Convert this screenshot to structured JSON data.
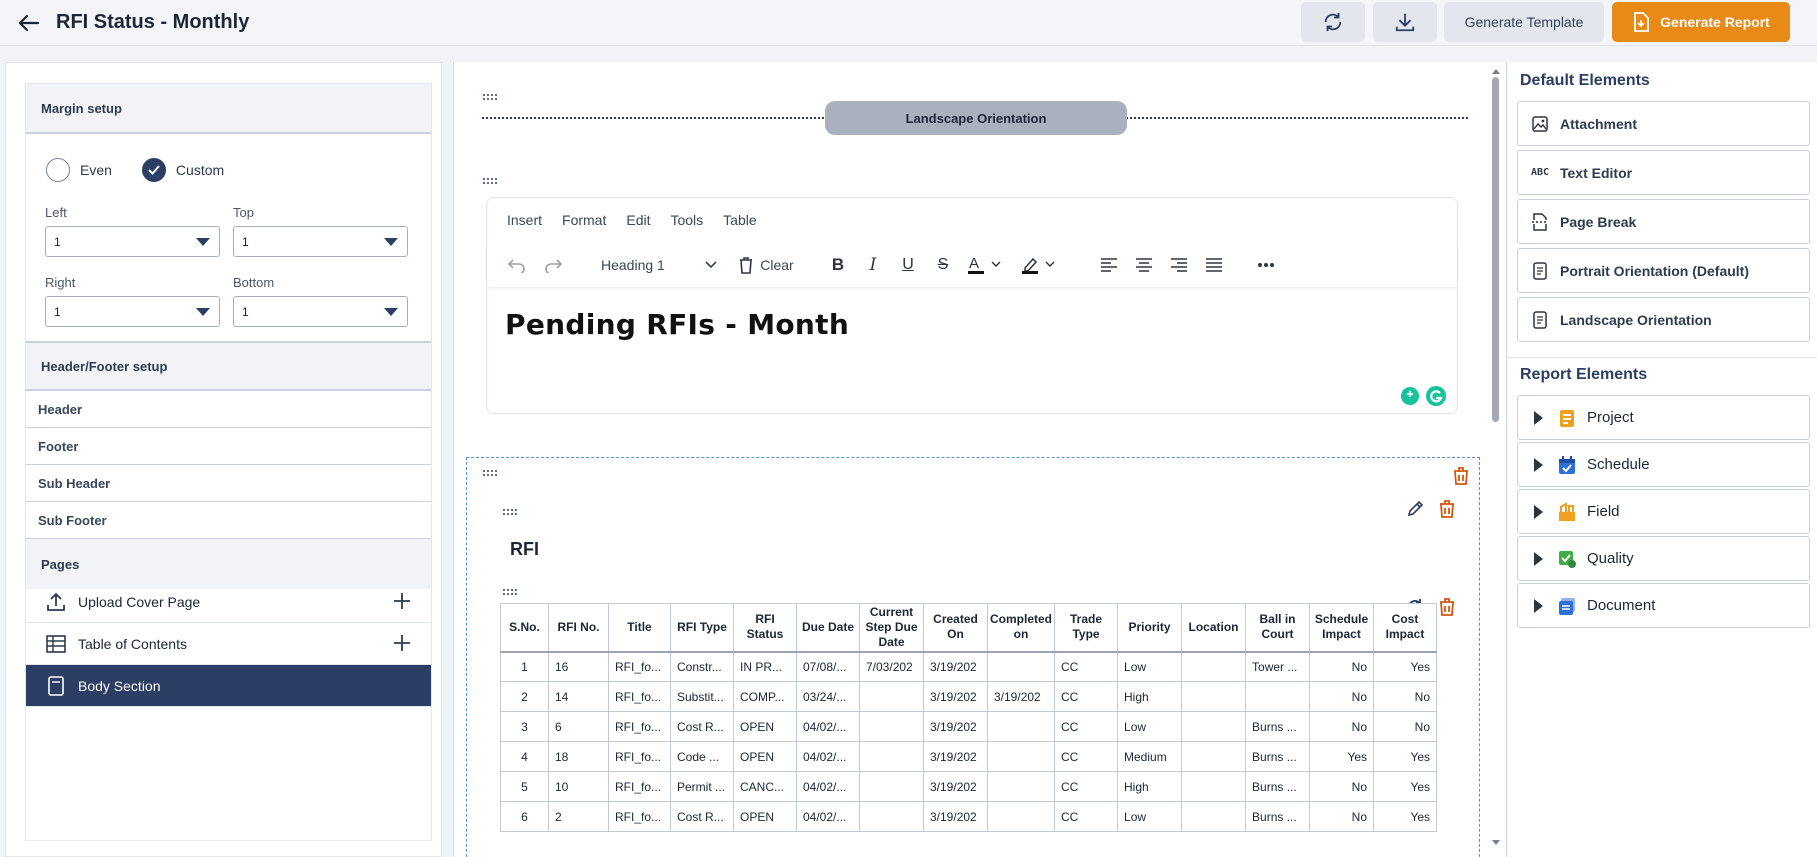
{
  "header": {
    "title": "RFI Status - Monthly",
    "generate_template": "Generate Template",
    "generate_report": "Generate Report",
    "refresh_icon": "refresh-icon",
    "download_icon": "download-icon",
    "accent_color": "#e98a16"
  },
  "left": {
    "margin_setup": "Margin setup",
    "radio_even": "Even",
    "radio_custom": "Custom",
    "selected_mode": "Custom",
    "left_label": "Left",
    "left_value": "1",
    "top_label": "Top",
    "top_value": "1",
    "right_label": "Right",
    "right_value": "1",
    "bottom_label": "Bottom",
    "bottom_value": "1",
    "header_footer_setup": "Header/Footer setup",
    "hf_items": [
      "Header",
      "Footer",
      "Sub Header",
      "Sub Footer"
    ],
    "pages_label": "Pages",
    "pages": [
      "Upload Cover Page",
      "Table of Contents",
      "Body Section"
    ],
    "active_page": "Body Section",
    "active_color": "#2c3e63"
  },
  "center": {
    "landscape_label": "Landscape Orientation",
    "menu": [
      "Insert",
      "Format",
      "Edit",
      "Tools",
      "Table"
    ],
    "heading_style": "Heading 1",
    "clear_label": "Clear",
    "content": "Pending RFIs - Month",
    "rfi_title": "RFI",
    "table": {
      "headers": [
        "S.No.",
        "RFI No.",
        "Title",
        "RFI Type",
        "RFI Status",
        "Due Date",
        "Current Step Due Date",
        "Created On",
        "Completed on",
        "Trade Type",
        "Priority",
        "Location",
        "Ball in Court",
        "Schedule Impact",
        "Cost Impact"
      ],
      "rows": [
        [
          "1",
          "16",
          "RFI_fo...",
          "Constr...",
          "IN PR...",
          "07/08/...",
          "7/03/202",
          "3/19/202",
          "",
          "CC",
          "Low",
          "",
          "Tower ...",
          "No",
          "Yes"
        ],
        [
          "2",
          "14",
          "RFI_fo...",
          "Substit...",
          "COMP...",
          "03/24/...",
          "",
          "3/19/202",
          "3/19/202",
          "CC",
          "High",
          "",
          "",
          "No",
          "No"
        ],
        [
          "3",
          "6",
          "RFI_fo...",
          "Cost R...",
          "OPEN",
          "04/02/...",
          "",
          "3/19/202",
          "",
          "CC",
          "Low",
          "",
          "Burns ...",
          "No",
          "No"
        ],
        [
          "4",
          "18",
          "RFI_fo...",
          "Code ...",
          "OPEN",
          "04/02/...",
          "",
          "3/19/202",
          "",
          "CC",
          "Medium",
          "",
          "Burns ...",
          "Yes",
          "Yes"
        ],
        [
          "5",
          "10",
          "RFI_fo...",
          "Permit ...",
          "CANC...",
          "04/02/...",
          "",
          "3/19/202",
          "",
          "CC",
          "High",
          "",
          "Burns ...",
          "No",
          "Yes"
        ],
        [
          "6",
          "2",
          "RFI_fo...",
          "Cost R...",
          "OPEN",
          "04/02/...",
          "",
          "3/19/202",
          "",
          "CC",
          "Low",
          "",
          "Burns ...",
          "No",
          "Yes"
        ]
      ]
    }
  },
  "right": {
    "default_heading": "Default Elements",
    "default_items": [
      {
        "label": "Attachment",
        "icon": "image-icon"
      },
      {
        "label": "Text Editor",
        "icon": "abc-icon"
      },
      {
        "label": "Page Break",
        "icon": "page-break-icon"
      },
      {
        "label": "Portrait Orientation (Default)",
        "icon": "document-icon"
      },
      {
        "label": "Landscape Orientation",
        "icon": "document-icon"
      }
    ],
    "report_heading": "Report Elements",
    "report_items": [
      {
        "label": "Project",
        "icon": "project-icon",
        "color": "#f0a020"
      },
      {
        "label": "Schedule",
        "icon": "calendar-icon",
        "color": "#2f6fd6"
      },
      {
        "label": "Field",
        "icon": "field-icon",
        "color": "#f0a020"
      },
      {
        "label": "Quality",
        "icon": "quality-icon",
        "color": "#3fae4a"
      },
      {
        "label": "Document",
        "icon": "document-stack-icon",
        "color": "#2f6fd6"
      }
    ]
  }
}
